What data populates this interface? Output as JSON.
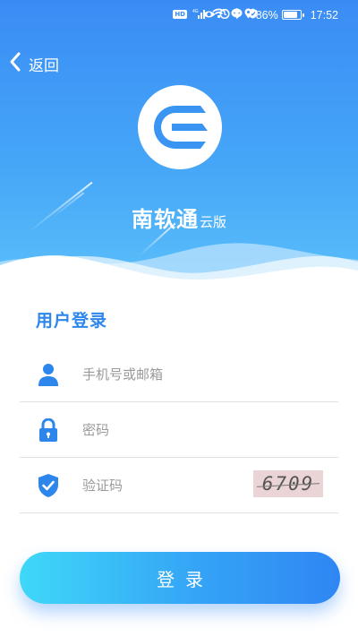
{
  "status_bar": {
    "net_chip": "HD",
    "signal_label": "4G",
    "battery_percent": "86%",
    "battery_level": 0.86,
    "time": "17:52"
  },
  "header": {
    "back_label": "返回",
    "app_name": "南软通",
    "app_suffix": "云版"
  },
  "form": {
    "section_title": "用户登录",
    "account_placeholder": "手机号或邮箱",
    "password_placeholder": "密码",
    "captcha_placeholder": "验证码",
    "captcha_image_text": "6709"
  },
  "login_button": "登录",
  "colors": {
    "brand_blue": "#2c86ec",
    "header_top": "#3a8cf5",
    "header_bottom": "#5cc0fa",
    "button_start": "#3fd8f8",
    "button_end": "#2f86f3"
  }
}
